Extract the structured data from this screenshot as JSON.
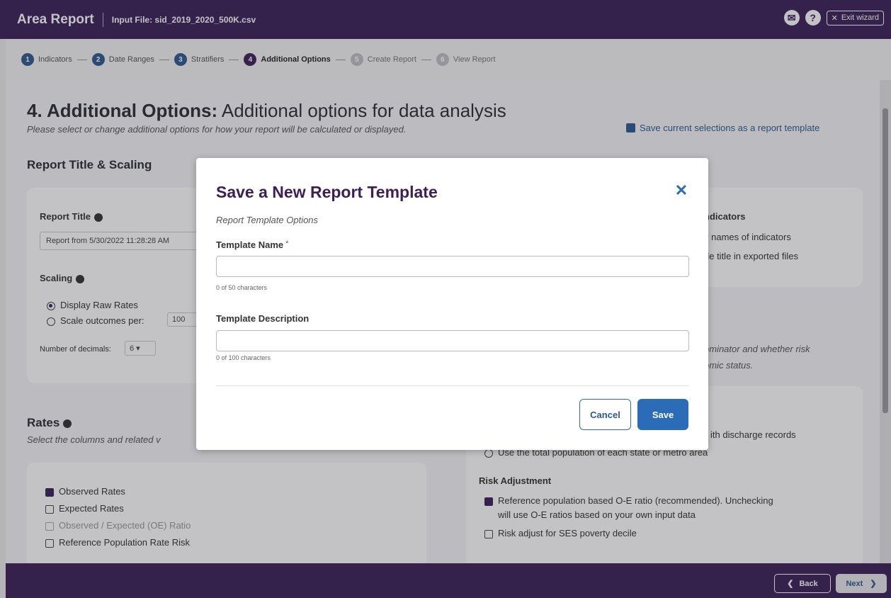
{
  "header": {
    "app_title": "Area Report",
    "input_file": "Input File: sid_2019_2020_500K.csv",
    "mail_icon_glyph": "✉",
    "help_icon_glyph": "?",
    "exit_label": "Exit wizard",
    "exit_icon_glyph": "✕"
  },
  "steps": [
    {
      "num": "1",
      "label": "Indicators",
      "state": "done"
    },
    {
      "num": "2",
      "label": "Date Ranges",
      "state": "done"
    },
    {
      "num": "3",
      "label": "Stratifiers",
      "state": "done"
    },
    {
      "num": "4",
      "label": "Additional Options",
      "state": "active"
    },
    {
      "num": "5",
      "label": "Create Report",
      "state": "future"
    },
    {
      "num": "6",
      "label": "View Report",
      "state": "future"
    }
  ],
  "page": {
    "title_bold": "4. Additional Options:",
    "title_rest": " Additional options for data analysis",
    "subtitle": "Please select or change additional options for how your report will be calculated or displayed.",
    "save_template_link": "Save current selections as a report template",
    "report_title_section": "Report Title & Scaling",
    "report_title_label": "Report Title",
    "report_title_value": "Report from 5/30/2022 11:28:28 AM",
    "scaling_label": "Scaling",
    "display_raw_rates": "Display Raw Rates",
    "scale_outcomes_per": "Scale outcomes per:",
    "scale_value": "100",
    "decimals_label": "Number of decimals:",
    "decimals_value": "6",
    "right_card_heading_partial": "ndicators",
    "right_card_line1": "v names of indicators",
    "right_card_line2": "de title in exported files",
    "right_italic_line1": "ominator and whether risk",
    "right_italic_line2": "omic status.",
    "discharge_text": "ith discharge records",
    "total_population_text": "Use the total population of each state or metro area",
    "rates_title": "Rates",
    "rates_sub": "Select the columns and related v",
    "rates_items": [
      {
        "label": "Observed Rates",
        "checked": true,
        "disabled": false
      },
      {
        "label": "Expected Rates",
        "checked": false,
        "disabled": false
      },
      {
        "label": "Observed / Expected (OE) Ratio",
        "checked": false,
        "disabled": true
      },
      {
        "label": "Reference Population Rate Risk",
        "checked": false,
        "disabled": false
      }
    ],
    "risk_adjustment_label": "Risk Adjustment",
    "risk_option1_line1": "Reference population based O-E ratio (recommended). Unchecking",
    "risk_option1_line2": "will use O-E ratios based on your own input data",
    "risk_option2": "Risk adjust for SES poverty decile"
  },
  "modal": {
    "title": "Save a New Report Template",
    "close_glyph": "✕",
    "subtitle": "Report Template Options",
    "name_label": "Template Name",
    "required_mark": "*",
    "name_value": "",
    "name_counter": "0 of 50 characters",
    "desc_label": "Template Description",
    "desc_value": "",
    "desc_counter": "0 of 100 characters",
    "cancel_label": "Cancel",
    "save_label": "Save"
  },
  "footer": {
    "back_label": "Back",
    "back_glyph": "❮",
    "next_label": "Next",
    "next_glyph": "❯"
  }
}
